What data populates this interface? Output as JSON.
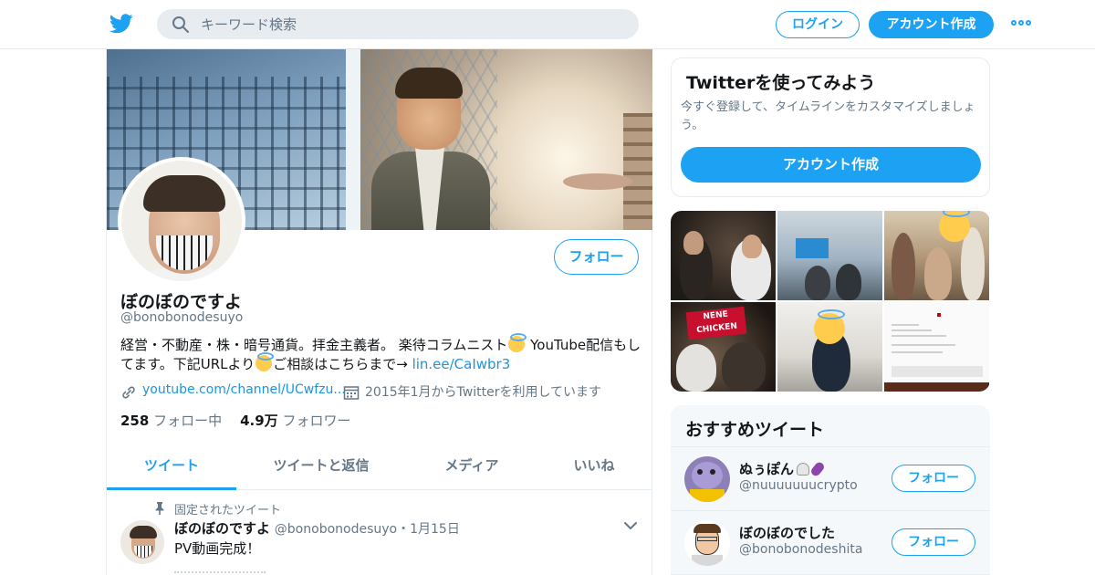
{
  "nav": {
    "search_placeholder": "キーワード検索",
    "login_label": "ログイン",
    "signup_label": "アカウント作成",
    "more_icon": "more-dots-icon",
    "brand_color": "#1da1f2"
  },
  "profile": {
    "name": "ぼのぼのですよ",
    "handle": "@bonobonodesuyo",
    "bio_part1": "経営・不動産・株・暗号通貨。拝金主義者。 楽待コラムニスト",
    "bio_part2": " YouTube配信もしてます。下記URLより",
    "bio_part3": "ご相談はこちらまで→ ",
    "bio_link": "lin.ee/CaIwbr3",
    "website": "youtube.com/channel/UCwfzu...",
    "joined": "2015年1月からTwitterを利用しています",
    "following_count": "258",
    "following_label": "フォロー中",
    "followers_count": "4.9万",
    "followers_label": "フォロワー",
    "follow_label": "フォロー"
  },
  "tabs": [
    {
      "label": "ツイート",
      "active": true
    },
    {
      "label": "ツイートと返信",
      "active": false
    },
    {
      "label": "メディア",
      "active": false
    },
    {
      "label": "いいね",
      "active": false
    }
  ],
  "pinned_tweet": {
    "pinned_label": "固定されたツイート",
    "author": "ぼのぼのですよ",
    "handle": "@bonobonodesuyo",
    "separator": "・",
    "date": "1月15日",
    "text": "PV動画完成！"
  },
  "signup_card": {
    "title": "Twitterを使ってみよう",
    "description": "今すぐ登録して、タイムラインをカスタマイズしましょう。",
    "button_label": "アカウント作成"
  },
  "media_grid": {
    "sign_text": "NENE CHICKEN"
  },
  "recommended": {
    "title": "おすすめツイート",
    "users": [
      {
        "name": "ぬぅぽん",
        "handle": "@nuuuuuuucrypto",
        "follow_label": "フォロー"
      },
      {
        "name": "ぼのぼのでした",
        "handle": "@bonobonodeshita",
        "follow_label": "フォロー"
      }
    ]
  }
}
